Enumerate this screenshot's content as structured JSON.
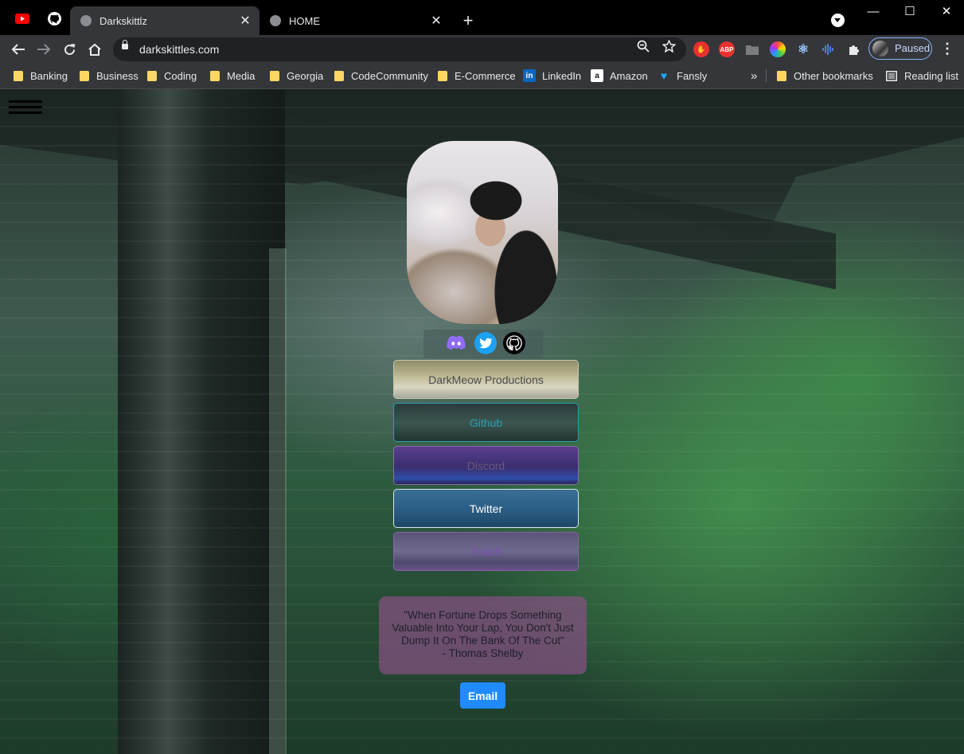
{
  "browser": {
    "tabs": [
      {
        "title": "Darkskittlz",
        "active": true
      },
      {
        "title": "HOME",
        "active": false
      }
    ],
    "pinned_tabs": [
      "youtube-icon",
      "github-icon"
    ],
    "new_tab_symbol": "+",
    "window_controls": {
      "minimize": "—",
      "maximize": "☐",
      "close": "✕"
    },
    "url": "darkskittles.com",
    "profile_status": "Paused",
    "extensions": [
      "adblock-hand-icon",
      "abp-icon",
      "folder-plus-icon",
      "color-wheel-icon",
      "react-icon",
      "audio-wave-icon",
      "puzzle-icon"
    ]
  },
  "bookmarks": [
    {
      "label": "Banking",
      "type": "folder"
    },
    {
      "label": "Business",
      "type": "folder"
    },
    {
      "label": "Coding",
      "type": "folder"
    },
    {
      "label": "Media",
      "type": "folder"
    },
    {
      "label": "Georgia",
      "type": "folder"
    },
    {
      "label": "CodeCommunity",
      "type": "folder"
    },
    {
      "label": "E-Commerce",
      "type": "folder"
    },
    {
      "label": "LinkedIn",
      "type": "site"
    },
    {
      "label": "Amazon",
      "type": "site"
    },
    {
      "label": "Fansly",
      "type": "site"
    }
  ],
  "bookmarks_overflow": "»",
  "other_bookmarks": "Other bookmarks",
  "reading_list": "Reading list",
  "page": {
    "social_icons": [
      "discord-icon",
      "twitter-icon",
      "github-icon"
    ],
    "links": [
      {
        "label": "DarkMeow Productions",
        "text_color": "#4a4a4a"
      },
      {
        "label": "Github",
        "text_color": "#2a9fb0"
      },
      {
        "label": "Discord",
        "text_color": "#6a5a7a"
      },
      {
        "label": "Twitter",
        "text_color": "#ffffff"
      },
      {
        "label": "Twitch",
        "text_color": "#7a4fb0"
      }
    ],
    "quote_lines": [
      "\"When Fortune Drops Something",
      "Valuable Into Your Lap, You Don't Just",
      "Dump It On The Bank Of The Cut\"",
      "- Thomas Shelby"
    ],
    "email_label": "Email"
  },
  "colors": {
    "accent_blue": "#1f8bff",
    "quote_bg": "#875082",
    "bookmark_folder": "#fdd663"
  }
}
